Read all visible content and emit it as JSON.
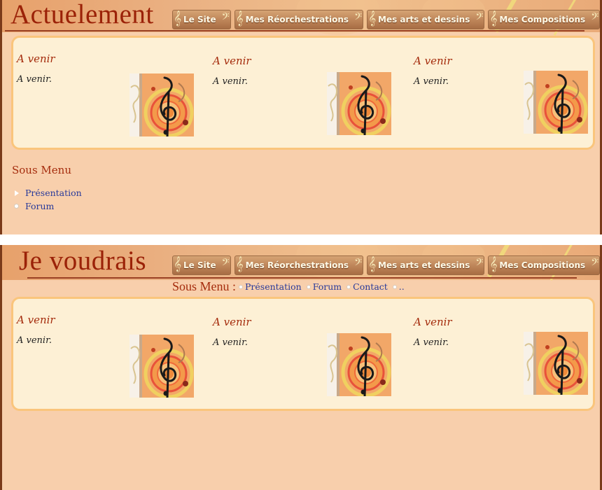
{
  "nav": {
    "items": [
      {
        "label": "Le Site"
      },
      {
        "label": "Mes Réorchestrations"
      },
      {
        "label": "Mes arts et dessins"
      },
      {
        "label": "Mes Compositions"
      }
    ]
  },
  "top": {
    "title": "Actuelement",
    "cards": [
      {
        "title": "A venir",
        "text": "A venir."
      },
      {
        "title": "A venir",
        "text": "A venir."
      },
      {
        "title": "A venir",
        "text": "A venir."
      }
    ],
    "submenu": {
      "title": "Sous Menu",
      "items": [
        {
          "label": "Présentation"
        },
        {
          "label": "Forum"
        }
      ]
    }
  },
  "bottom": {
    "title": "Je voudrais",
    "submenu": {
      "title": "Sous Menu :",
      "items": [
        {
          "label": "Présentation"
        },
        {
          "label": "Forum"
        },
        {
          "label": "Contact"
        },
        {
          "label": ".."
        }
      ]
    },
    "cards": [
      {
        "title": "A venir",
        "text": "A venir."
      },
      {
        "title": "A venir",
        "text": "A venir."
      },
      {
        "title": "A venir",
        "text": "A venir."
      }
    ]
  },
  "colors": {
    "background": "#f8cfac",
    "box": "#fdf0d5",
    "box_border": "#fac57c",
    "title": "#9b2208",
    "link": "#27399a",
    "nav_button": "#bd8458"
  },
  "icons": {
    "nav_left": "treble-clef-icon",
    "nav_right": "bass-clef-icon",
    "card_image": "music-art-thumbnail"
  }
}
